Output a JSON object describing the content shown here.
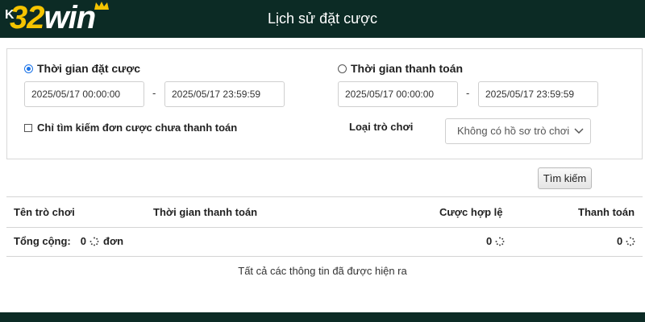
{
  "header": {
    "back_label": "K",
    "logo_number": "32",
    "logo_word": "win",
    "title": "Lịch sử đặt cược",
    "background_color": "#0c2b25",
    "logo_accent_color": "#f5c400"
  },
  "filters": {
    "bet_time": {
      "label": "Thời gian đặt cược",
      "selected": true,
      "from": "2025/05/17 00:00:00",
      "to": "2025/05/17 23:59:59"
    },
    "payment_time": {
      "label": "Thời gian thanh toán",
      "selected": false,
      "from": "2025/05/17 00:00:00",
      "to": "2025/05/17 23:59:59"
    },
    "separator": "-",
    "unpaid_only": {
      "label": "Chỉ tìm kiếm đơn cược chưa thanh toán",
      "checked": false
    },
    "game_type": {
      "label": "Loại trò chơi",
      "selected_value": "Không có hồ sơ trò chơi"
    },
    "search_label": "Tìm kiếm"
  },
  "table": {
    "columns": [
      "Tên trò chơi",
      "Thời gian thanh toán",
      "Cược hợp lệ",
      "Thanh toán"
    ],
    "totals": {
      "label": "Tổng cộng:",
      "count": "0",
      "count_unit": "đơn",
      "valid_bet": "0",
      "payout": "0"
    },
    "footer_note": "Tất cả các thông tin đã được hiện ra"
  }
}
